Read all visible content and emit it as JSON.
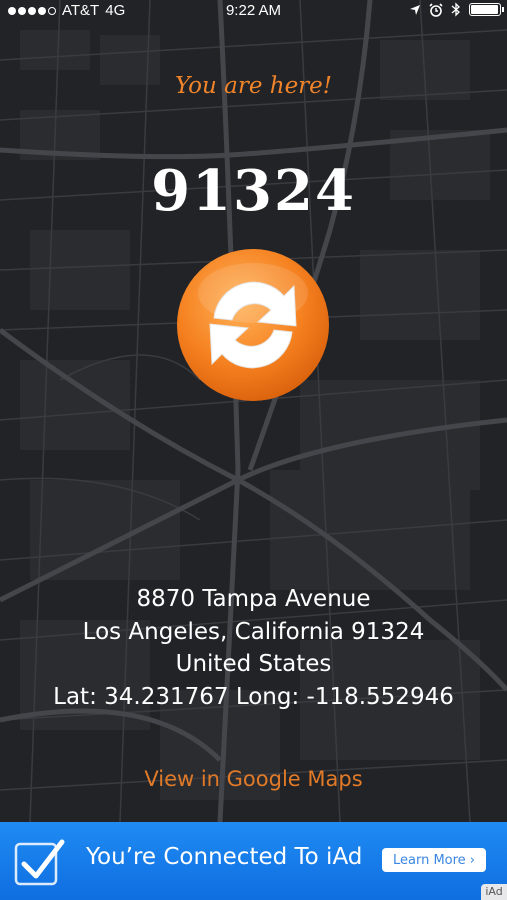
{
  "status_bar": {
    "carrier": "AT&T",
    "network": "4G",
    "time": "9:22 AM",
    "signal_bars": 4,
    "signal_total": 5,
    "icons": [
      "location-arrow-icon",
      "alarm-icon",
      "bluetooth-icon",
      "battery-icon"
    ],
    "battery_level": 0.95
  },
  "header": {
    "you_are_here": "You are here!"
  },
  "location": {
    "zip": "91324",
    "address_line1": "8870 Tampa Avenue",
    "address_line2": "Los Angeles, California 91324",
    "country": "United States",
    "coords": "Lat: 34.231767 Long: -118.552946"
  },
  "refresh_button": {
    "icon": "refresh-icon"
  },
  "maps_link": "View in Google Maps",
  "ad_banner": {
    "icon": "checkmark-icon",
    "text": "You’re Connected To iAd",
    "button_label": "Learn More ›",
    "tag": "iAd"
  },
  "colors": {
    "accent_orange": "#f0842a",
    "map_background": "#222326",
    "ad_blue": "#1a82ee"
  }
}
